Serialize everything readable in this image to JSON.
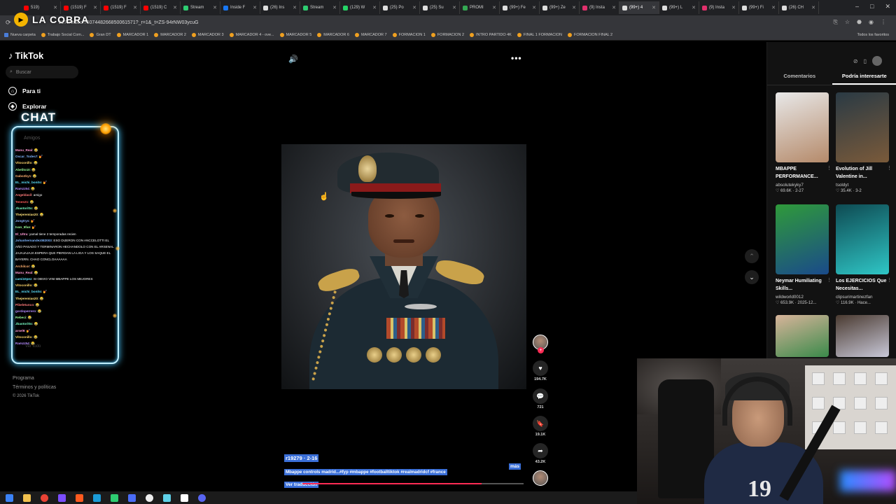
{
  "browser": {
    "tabs": [
      {
        "label": "519)",
        "color": "#ff0000"
      },
      {
        "label": "(1519) F",
        "color": "#ff0000"
      },
      {
        "label": "(1519) F",
        "color": "#ff0000"
      },
      {
        "label": "(1519) C",
        "color": "#ff0000"
      },
      {
        "label": "Stream",
        "color": "#2ecc71"
      },
      {
        "label": "Inside F",
        "color": "#1877f2"
      },
      {
        "label": "(26) Ins",
        "color": "#dddddd"
      },
      {
        "label": "Stream",
        "color": "#2ecc71"
      },
      {
        "label": "(129) W",
        "color": "#25d366"
      },
      {
        "label": "(25) Po",
        "color": "#dddddd"
      },
      {
        "label": "(25) Su",
        "color": "#dddddd"
      },
      {
        "label": "PROMI",
        "color": "#34a853"
      },
      {
        "label": "(99+) Fe",
        "color": "#dddddd"
      },
      {
        "label": "(99+) Ze",
        "color": "#dddddd"
      },
      {
        "label": "(9) Insta",
        "color": "#e1306c"
      },
      {
        "label": "(99+) 4",
        "color": "#dddddd"
      },
      {
        "label": "(99+) L",
        "color": "#dddddd"
      },
      {
        "label": "(9) Insta",
        "color": "#e1306c"
      },
      {
        "label": "(99+) Fi",
        "color": "#dddddd"
      },
      {
        "label": "(26) CH",
        "color": "#dddddd"
      }
    ],
    "active_tab_index": 15,
    "url": "9279/video/7607448266850061571?_r=1&_t=ZS-94rNW03ycuG",
    "bookmarks": [
      "Nueva carpeta",
      "Trabajo Social Com...",
      "Gran DT",
      "MARCADOR 1",
      "MARCADOR 2",
      "MARCADOR 3",
      "MARCADOR 4 - ove...",
      "MARCADOR 5",
      "MARCADOR 6",
      "MARCADOR 7",
      "FORMACION 1",
      "FORMACION 2",
      "INTRO PARTIDO 4K",
      "FINAL 1 FORMACION",
      "FORMACION FINAL 2"
    ],
    "all_favorites": "Todos los favoritos"
  },
  "stream_overlay": {
    "channel_name": "LA COBRA",
    "chat_title": "CHAT"
  },
  "sidebar": {
    "logo": "TikTok",
    "search_placeholder": "Buscar",
    "items": [
      {
        "label": "Para ti",
        "icon": "home-icon"
      },
      {
        "label": "Explorar",
        "icon": "compass-icon"
      }
    ],
    "friends_label": "Amigos",
    "see_all": "Ver todo",
    "footer": {
      "program": "Programa",
      "terms": "Términos y políticas",
      "copyright": "© 2026 TikTok"
    }
  },
  "chat_messages": [
    {
      "user": "Manu_Real",
      "text": ": 😂",
      "color": "#ff9ad5"
    },
    {
      "user": "Oscar_Todes7",
      "text": ": 💅",
      "color": "#7fb6ff"
    },
    {
      "user": "Vitoconillo",
      "text": ": 😂",
      "color": "#ffd76b"
    },
    {
      "user": "Abelito10",
      "text": ": 😂",
      "color": "#9aff9a"
    },
    {
      "user": "Gabo2by1",
      "text": ": 😂",
      "color": "#ffb070"
    },
    {
      "user": "EL_michi_bonito",
      "text": ": 💅",
      "color": "#5ee3ff"
    },
    {
      "user": "Ramzz54",
      "text": ": 😂",
      "color": "#b58cff"
    },
    {
      "user": "Angeldavil",
      "text": ": amigo",
      "color": "#ff7a7a"
    },
    {
      "user": "Tenes21",
      "text": ": 😂",
      "color": "#ff5a5a"
    },
    {
      "user": "Jbaotoritto",
      "text": ": 😂",
      "color": "#7affc8"
    },
    {
      "user": "Thejeremias20",
      "text": ": 😂",
      "color": "#ffe27a"
    },
    {
      "user": "Jongtrys",
      "text": ": 💅",
      "color": "#8ab4ff"
    },
    {
      "user": "Ivan_5fan",
      "text": ": 💅",
      "color": "#9aff9a"
    },
    {
      "user": "El_Ultra",
      "text": ": yamal tiene 2 temporadas recien",
      "color": "#ff9ad5"
    },
    {
      "user": "Johanhernandez082003",
      "text": ": ESO DIJERON CON ANCCELOTTI EL",
      "color": "#7fb6ff"
    },
    {
      "user": "",
      "text": "AÑO PASADO Y TERMINARON HECHANDOLO CON EL ARSENAL",
      "color": "#ffffff"
    },
    {
      "user": "",
      "text": "JAJAJAJAJA ESPERA QUE PIERDAN LA LIGA Y LOS SAQUE EL",
      "color": "#ffffff"
    },
    {
      "user": "",
      "text": "BAYERN. CHAO CONCLOAAAAAA",
      "color": "#ffffff"
    },
    {
      "user": "Archilcor",
      "text": ": 😂",
      "color": "#ffb070"
    },
    {
      "user": "Manu_Real",
      "text": ": 😂",
      "color": "#ff9ad5"
    },
    {
      "user": "cami10pez",
      "text": ": SI OBVIO VINI MBAPPE LOS MEJORES",
      "color": "#5ee3ff"
    },
    {
      "user": "Vitoconillo",
      "text": ": 😂",
      "color": "#ffd76b"
    },
    {
      "user": "EL_michi_bonito",
      "text": ": 💅",
      "color": "#5ee3ff"
    },
    {
      "user": "Thejeremias20",
      "text": ": 😂",
      "color": "#ffe27a"
    },
    {
      "user": "Pibeletunco",
      "text": ": 😂",
      "color": "#ff7a7a"
    },
    {
      "user": "gordoperrero",
      "text": ": 😂",
      "color": "#b58cff"
    },
    {
      "user": "Rebeci",
      "text": ": 😂",
      "color": "#9aff9a"
    },
    {
      "user": "Jbaotoritto",
      "text": ": 😂",
      "color": "#7affc8"
    },
    {
      "user": "arsel9",
      "text": ": 💅",
      "color": "#ff9ad5"
    },
    {
      "user": "Vitoconillo",
      "text": ": 😂",
      "color": "#ffd76b"
    },
    {
      "user": "Ramzz54",
      "text": ": 😂",
      "color": "#b58cff"
    }
  ],
  "video": {
    "author_date": "r19279 · 2-16",
    "description": "Mbappe controls madrid...#fyp #mbappe #footballtiktok #realmadridcf #france",
    "more": "más",
    "translate": "Ver traducción",
    "progress": 0.81,
    "likes": "194.7K",
    "comments": "721",
    "saves": "19.1K",
    "shares": "43.2K"
  },
  "right_panel": {
    "tabs": [
      "Comentarios",
      "Podría interesarte"
    ],
    "active_tab": 1,
    "cards": [
      {
        "title": "MBAPPE PERFORMANCE...",
        "user": "absolutekyky7",
        "likes": "69.6K",
        "date": "2-27",
        "colors": [
          "#e8e8e8",
          "#b58a6a"
        ]
      },
      {
        "title": "Evolution of Jill Valentine in...",
        "user": "tsoldyt",
        "likes": "35.4K",
        "date": "3-2",
        "colors": [
          "#2a3a44",
          "#7a5a3a"
        ]
      },
      {
        "title": "Neymar Humiliating Skills...",
        "user": "wildworld0012",
        "likes": "653.9K",
        "date": "2025-12...",
        "colors": [
          "#2f9a3a",
          "#1a4a8a"
        ]
      },
      {
        "title": "Los EJERCICIOS Que Necesitas...",
        "user": "clipsurimartinezfan",
        "likes": "116.9K",
        "date": "Hace...",
        "colors": [
          "#0e4a52",
          "#2fc6c6"
        ]
      },
      {
        "title": "",
        "user": "",
        "likes": "",
        "date": "",
        "colors": [
          "#d8b49a",
          "#3a8a4a"
        ]
      },
      {
        "title": "",
        "user": "",
        "likes": "",
        "date": "",
        "colors": [
          "#4a3a30",
          "#c8c8d8"
        ]
      }
    ]
  }
}
